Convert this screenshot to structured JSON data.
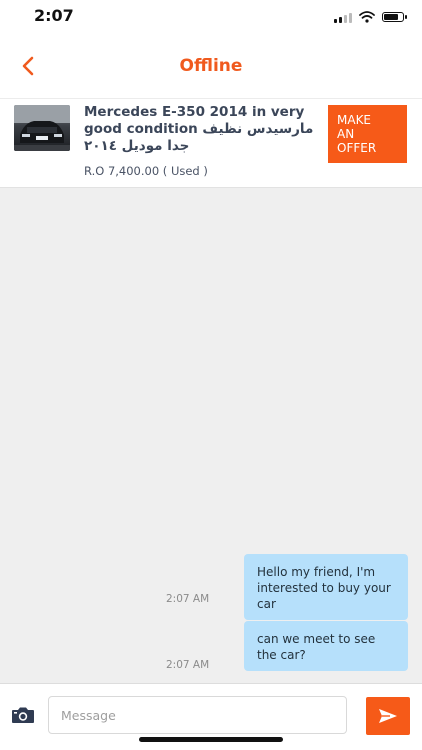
{
  "status_bar": {
    "time": "2:07"
  },
  "nav": {
    "title": "Offline",
    "accent": "#f05a1e"
  },
  "listing": {
    "title": "Mercedes E-350 2014 in very good condition  مارسيدس نظيف جدا موديل ٢٠١٤",
    "price": "R.O 7,400.00 ( Used )",
    "offer_label": "MAKE\nAN\nOFFER"
  },
  "messages": [
    {
      "text": "Hello my friend, I'm interested to buy your car",
      "time": "2:07 AM"
    },
    {
      "text": "can we meet to see the car?",
      "time": "2:07 AM"
    }
  ],
  "composer": {
    "placeholder": "Message"
  },
  "colors": {
    "accent": "#f65a18",
    "bubble": "#b6e0fb",
    "background": "#efefef"
  }
}
